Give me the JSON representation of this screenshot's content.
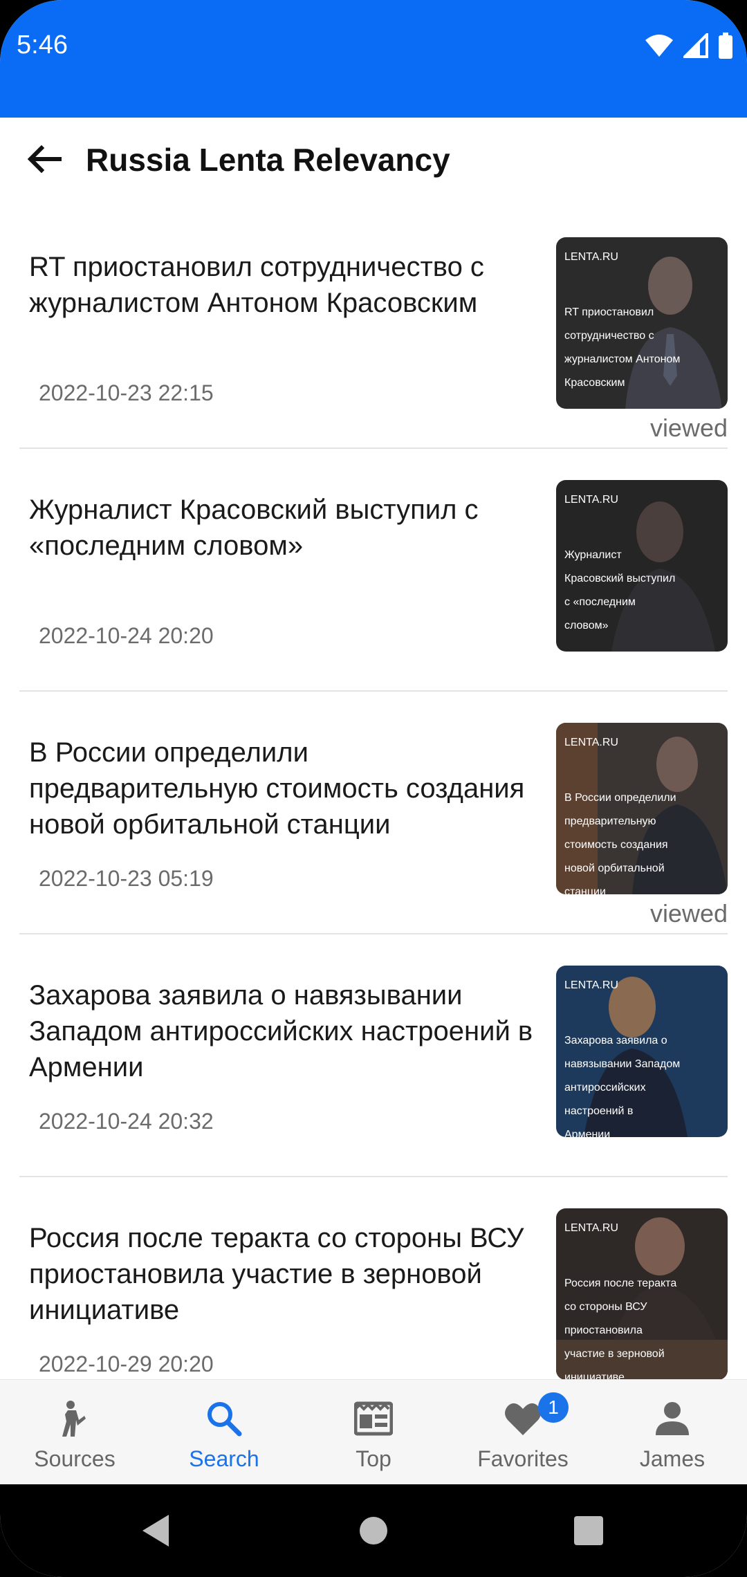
{
  "status_bar": {
    "time": "5:46"
  },
  "app_bar": {
    "title": "Russia Lenta Relevancy"
  },
  "articles": [
    {
      "title": "RT приостановил сотрудничество с журналистом Антоном Красовским",
      "date": "2022-10-23 22:15",
      "thumb_logo": "LENTA.RU",
      "thumb_text": "RT приостановил сотрудничество с журналистом Антоном Красовским",
      "viewed": "viewed"
    },
    {
      "title": "Журналист Красовский выступил с «последним словом»",
      "date": "2022-10-24 20:20",
      "thumb_logo": "LENTA.RU",
      "thumb_text": "Журналист Красовский выступил с «последним словом»",
      "viewed": ""
    },
    {
      "title": "В России определили предварительную стоимость создания новой орбитальной станции",
      "date": "2022-10-23 05:19",
      "thumb_logo": "LENTA.RU",
      "thumb_text": "В России определили предварительную стоимость создания новой орбитальной станции",
      "viewed": "viewed"
    },
    {
      "title": "Захарова заявила о навязывании Западом антироссийских настроений в Армении",
      "date": "2022-10-24 20:32",
      "thumb_logo": "LENTA.RU",
      "thumb_text": "Захарова заявила о навязывании Западом антироссийских настроений в Армении",
      "viewed": ""
    },
    {
      "title": "Россия после теракта со стороны ВСУ приостановила участие в зерновой инициативе",
      "date": "2022-10-29 20:20",
      "thumb_logo": "LENTA.RU",
      "thumb_text": "Россия после теракта со стороны ВСУ приостановила участие в зерновой инициативе",
      "viewed": ""
    }
  ],
  "bottom_nav": {
    "items": [
      {
        "label": "Sources",
        "icon": "person-walking-icon",
        "active": false
      },
      {
        "label": "Search",
        "icon": "search-icon",
        "active": true
      },
      {
        "label": "Top",
        "icon": "newspaper-icon",
        "active": false
      },
      {
        "label": "Favorites",
        "icon": "heart-icon",
        "active": false,
        "badge": "1"
      },
      {
        "label": "James",
        "icon": "account-icon",
        "active": false
      }
    ]
  },
  "colors": {
    "status_bar": "#0a6cf5",
    "accent": "#1a73e8",
    "thumb_dark": "#2a2a2a",
    "thumb_navy": "#1d3a5c"
  }
}
